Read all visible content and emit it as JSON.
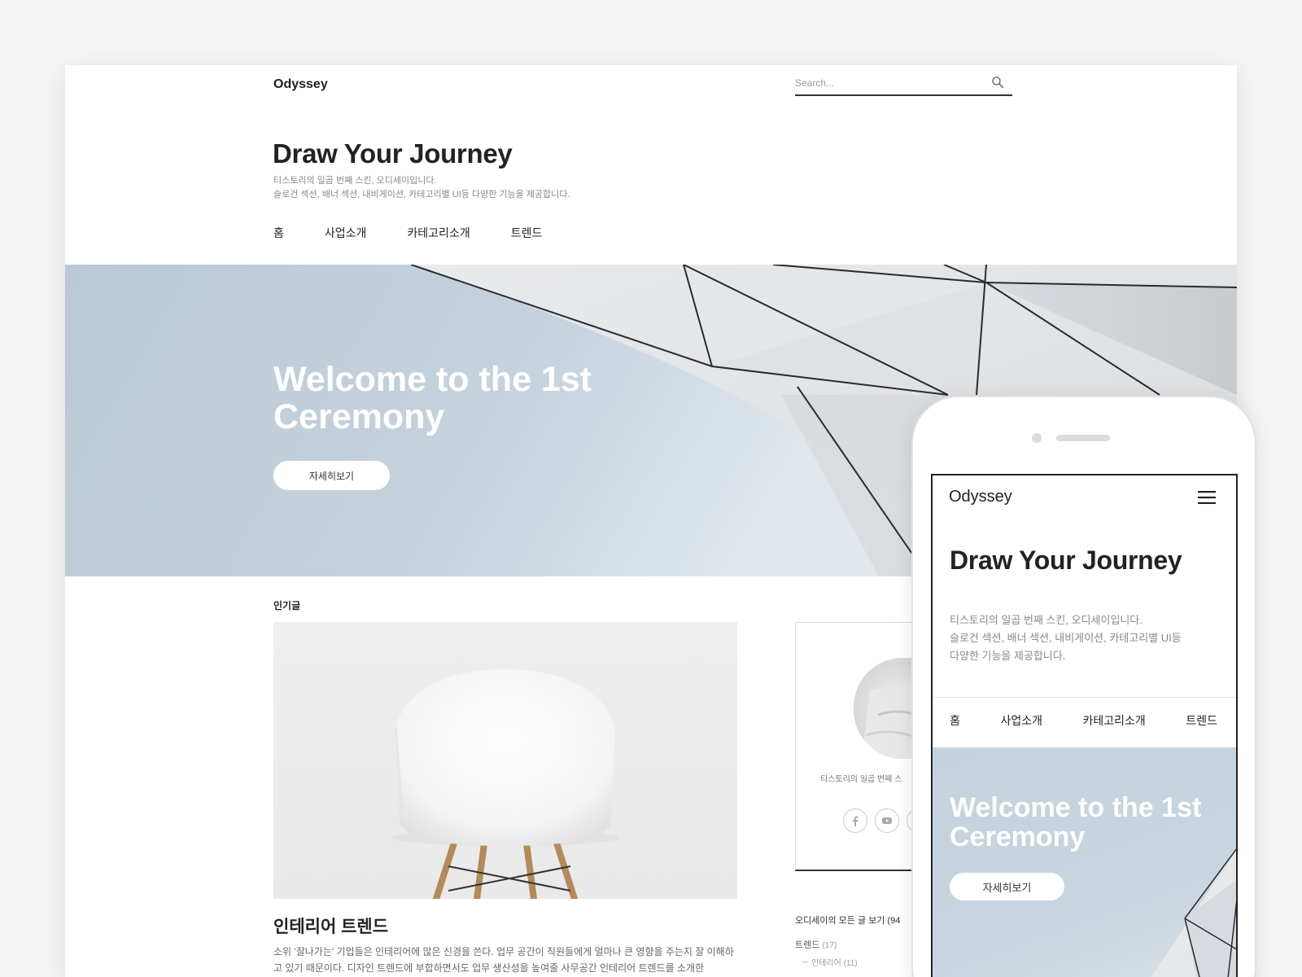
{
  "desktop": {
    "logo": "Odyssey",
    "search": {
      "placeholder": "Search..."
    },
    "title": "Draw Your Journey",
    "description": [
      "티스토리의 일곱 번째 스킨, 오디세이입니다.",
      "슬로건 섹션, 배너 섹션, 내비게이션, 카테고리별 UI등 다양한 기능을 제공합니다."
    ],
    "nav": [
      "홈",
      "사업소개",
      "카테고리소개",
      "트렌드"
    ],
    "hero": {
      "title": "Welcome to the 1st Ceremony",
      "button": "자세히보기"
    },
    "popular": {
      "label": "인기글",
      "post_title": "인테리어 트렌드",
      "post_text": "소위 '잘나가는' 기업들은 인테리어에 많은 신경을 쓴다. 업무 공간이 직원들에게 얼마나 큰 영향을 주는지 잘 이해하고 있기 때문이다. 디자인 트렌드에 부합하면서도 업무 생산성을 높여줄 사무공간 인테리어 트렌드를 소개한"
    },
    "sidebar": {
      "profile_desc": "티스토리의 일곱 번째 스",
      "social_icons": [
        "facebook-icon",
        "youtube-icon",
        "instagram-icon"
      ],
      "all_posts": "오디세이의 모든 글 보기 (94",
      "categories": [
        {
          "name": "트렌드",
          "count": "(17)"
        },
        {
          "name": "ㅡ 인테리어",
          "count": "(11)"
        }
      ]
    }
  },
  "mobile": {
    "logo": "Odyssey",
    "menu_icon": "hamburger-menu-icon",
    "title": "Draw Your Journey",
    "description": [
      "티스토리의 일곱 번째 스킨, 오디세이입니다.",
      "슬로건 섹션, 배너 섹션, 내비게이션, 카테고리별 UI등",
      "다양한 기능을 제공합니다."
    ],
    "nav": [
      "홈",
      "사업소개",
      "카테고리소개",
      "트렌드"
    ],
    "hero": {
      "title": "Welcome to the 1st Ceremony",
      "button": "자세히보기"
    }
  },
  "colors": {
    "page_background": "#f5f5f5",
    "hero_blue": "#c2d0dc",
    "text_dark": "#222222",
    "text_muted": "#888888"
  }
}
